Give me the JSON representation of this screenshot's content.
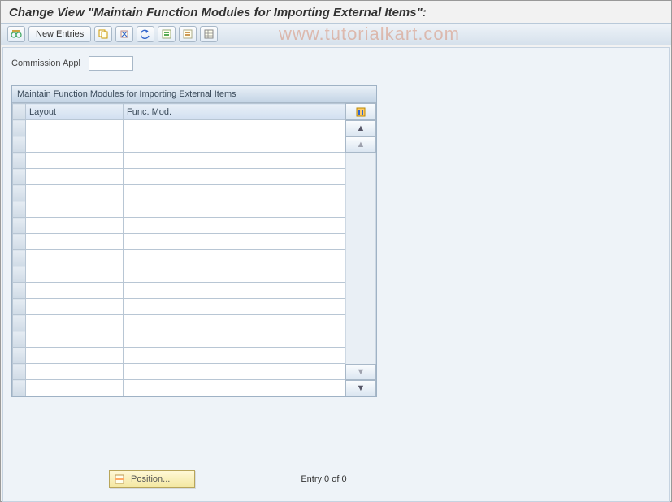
{
  "title": "Change View \"Maintain Function Modules for Importing External Items\":",
  "watermark": "www.tutorialkart.com",
  "toolbar": {
    "new_entries": "New Entries"
  },
  "field": {
    "commission_appl_label": "Commission Appl",
    "commission_appl_value": ""
  },
  "panel": {
    "title": "Maintain Function Modules for Importing External Items",
    "columns": {
      "layout": "Layout",
      "func_mod": "Func. Mod."
    },
    "row_count": 17
  },
  "footer": {
    "position_label": "Position...",
    "entry_text": "Entry 0 of 0"
  }
}
